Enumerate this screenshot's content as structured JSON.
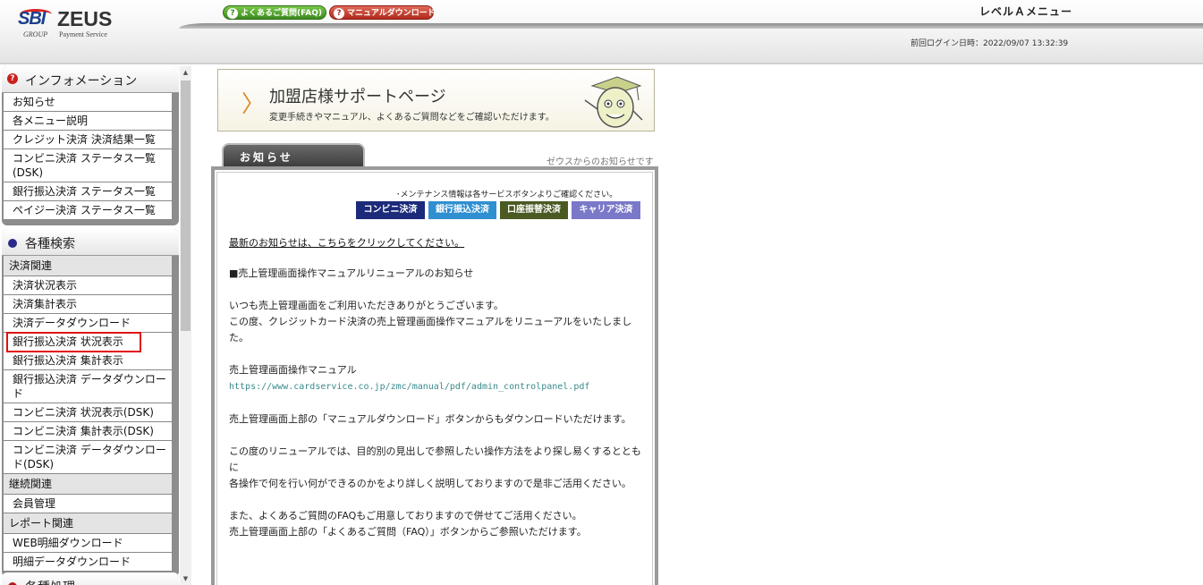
{
  "header": {
    "logo": {
      "sbi": "SBI",
      "zeus": "ZEUS",
      "group": "GROUP",
      "payment_service": "Payment Service"
    },
    "faq_button": "よくあるご質問(FAQ)",
    "manual_button": "マニュアルダウンロード",
    "level_title": "レベルＡメニュー",
    "last_login": "前回ログイン日時：2022/09/07 13:32:39"
  },
  "sidebar": {
    "info": {
      "title": "インフォメーション",
      "items": [
        "お知らせ",
        "各メニュー説明",
        "クレジット決済 決済結果一覧",
        "コンビニ決済 ステータス一覧(DSK)",
        "銀行振込決済 ステータス一覧",
        "ペイジー決済 ステータス一覧"
      ]
    },
    "search": {
      "title": "各種検索",
      "cat_payment": "決済関連",
      "payment_items": [
        "決済状況表示",
        "決済集計表示",
        "決済データダウンロード",
        "銀行振込決済 状況表示",
        "銀行振込決済 集計表示",
        "銀行振込決済 データダウンロード",
        "コンビニ決済 状況表示(DSK)",
        "コンビニ決済 集計表示(DSK)",
        "コンビニ決済 データダウンロード(DSK)"
      ],
      "cat_continuous": "継続関連",
      "continuous_items": [
        "会員管理"
      ],
      "cat_report": "レポート関連",
      "report_items": [
        "WEB明細ダウンロード",
        "明細データダウンロード"
      ]
    },
    "next_panel_title": "各種処理"
  },
  "main": {
    "support": {
      "title": "加盟店様サポートページ",
      "subtitle": "変更手続きやマニュアル、よくあるご質問などをご確認いただけます。"
    },
    "tab_label": "お知らせ",
    "tab_note": "ゼウスからのお知らせです",
    "maintenance_note": "･メンテナンス情報は各サービスボタンよりご確認ください。",
    "service_buttons": [
      "コンビニ決済",
      "銀行振込決済",
      "口座振替決済",
      "キャリア決済"
    ],
    "latest_link": "最新のお知らせは、こちらをクリックしてください。",
    "notice_heading": "■売上管理画面操作マニュアルリニューアルのお知らせ",
    "p1": "いつも売上管理画面をご利用いただきありがとうございます。",
    "p2": "この度、クレジットカード決済の売上管理画面操作マニュアルをリニューアルをいたしました。",
    "manual_label": "売上管理画面操作マニュアル",
    "manual_url": "https://www.cardservice.co.jp/zmc/manual/pdf/admin_controlpanel.pdf",
    "p3": "売上管理画面上部の「マニュアルダウンロード」ボタンからもダウンロードいただけます。",
    "p4a": "この度のリニューアルでは、目的別の見出しで参照したい操作方法をより探し易くするとともに",
    "p4b": "各操作で何を行い何ができるのかをより詳しく説明しておりますので是非ご活用ください。",
    "p5a": "また、よくあるご質問のFAQもご用意しておりますので併せてご活用ください。",
    "p5b": "売上管理画面上部の「よくあるご質問（FAQ）」ボタンからご参照いただけます。"
  }
}
